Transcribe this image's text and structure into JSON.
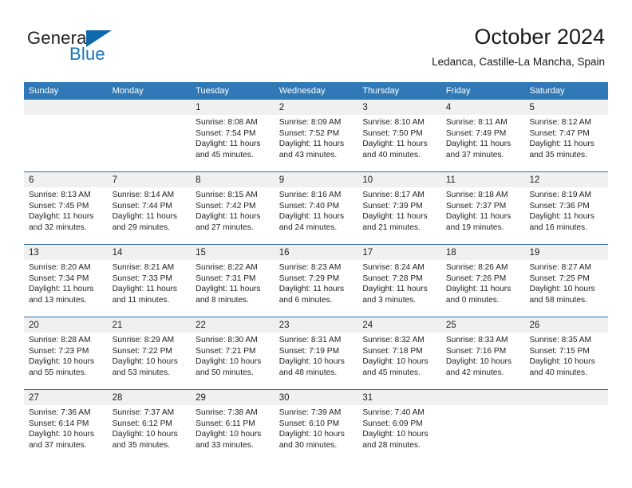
{
  "brand": {
    "word_general": "General",
    "word_blue": "Blue",
    "flag_icon": "triangle-flag-icon",
    "accent_color": "#1574b8"
  },
  "header": {
    "title": "October 2024",
    "subtitle": "Ledanca, Castille-La Mancha, Spain",
    "header_bg_color": "#3079b6",
    "row_divider_color": "#2f6ea5",
    "day_band_color": "#f0f0f0"
  },
  "weekdays": [
    "Sunday",
    "Monday",
    "Tuesday",
    "Wednesday",
    "Thursday",
    "Friday",
    "Saturday"
  ],
  "weeks": [
    [
      {
        "day": "",
        "lines": []
      },
      {
        "day": "",
        "lines": []
      },
      {
        "day": "1",
        "lines": [
          "Sunrise: 8:08 AM",
          "Sunset: 7:54 PM",
          "Daylight: 11 hours",
          "and 45 minutes."
        ]
      },
      {
        "day": "2",
        "lines": [
          "Sunrise: 8:09 AM",
          "Sunset: 7:52 PM",
          "Daylight: 11 hours",
          "and 43 minutes."
        ]
      },
      {
        "day": "3",
        "lines": [
          "Sunrise: 8:10 AM",
          "Sunset: 7:50 PM",
          "Daylight: 11 hours",
          "and 40 minutes."
        ]
      },
      {
        "day": "4",
        "lines": [
          "Sunrise: 8:11 AM",
          "Sunset: 7:49 PM",
          "Daylight: 11 hours",
          "and 37 minutes."
        ]
      },
      {
        "day": "5",
        "lines": [
          "Sunrise: 8:12 AM",
          "Sunset: 7:47 PM",
          "Daylight: 11 hours",
          "and 35 minutes."
        ]
      }
    ],
    [
      {
        "day": "6",
        "lines": [
          "Sunrise: 8:13 AM",
          "Sunset: 7:45 PM",
          "Daylight: 11 hours",
          "and 32 minutes."
        ]
      },
      {
        "day": "7",
        "lines": [
          "Sunrise: 8:14 AM",
          "Sunset: 7:44 PM",
          "Daylight: 11 hours",
          "and 29 minutes."
        ]
      },
      {
        "day": "8",
        "lines": [
          "Sunrise: 8:15 AM",
          "Sunset: 7:42 PM",
          "Daylight: 11 hours",
          "and 27 minutes."
        ]
      },
      {
        "day": "9",
        "lines": [
          "Sunrise: 8:16 AM",
          "Sunset: 7:40 PM",
          "Daylight: 11 hours",
          "and 24 minutes."
        ]
      },
      {
        "day": "10",
        "lines": [
          "Sunrise: 8:17 AM",
          "Sunset: 7:39 PM",
          "Daylight: 11 hours",
          "and 21 minutes."
        ]
      },
      {
        "day": "11",
        "lines": [
          "Sunrise: 8:18 AM",
          "Sunset: 7:37 PM",
          "Daylight: 11 hours",
          "and 19 minutes."
        ]
      },
      {
        "day": "12",
        "lines": [
          "Sunrise: 8:19 AM",
          "Sunset: 7:36 PM",
          "Daylight: 11 hours",
          "and 16 minutes."
        ]
      }
    ],
    [
      {
        "day": "13",
        "lines": [
          "Sunrise: 8:20 AM",
          "Sunset: 7:34 PM",
          "Daylight: 11 hours",
          "and 13 minutes."
        ]
      },
      {
        "day": "14",
        "lines": [
          "Sunrise: 8:21 AM",
          "Sunset: 7:33 PM",
          "Daylight: 11 hours",
          "and 11 minutes."
        ]
      },
      {
        "day": "15",
        "lines": [
          "Sunrise: 8:22 AM",
          "Sunset: 7:31 PM",
          "Daylight: 11 hours",
          "and 8 minutes."
        ]
      },
      {
        "day": "16",
        "lines": [
          "Sunrise: 8:23 AM",
          "Sunset: 7:29 PM",
          "Daylight: 11 hours",
          "and 6 minutes."
        ]
      },
      {
        "day": "17",
        "lines": [
          "Sunrise: 8:24 AM",
          "Sunset: 7:28 PM",
          "Daylight: 11 hours",
          "and 3 minutes."
        ]
      },
      {
        "day": "18",
        "lines": [
          "Sunrise: 8:26 AM",
          "Sunset: 7:26 PM",
          "Daylight: 11 hours",
          "and 0 minutes."
        ]
      },
      {
        "day": "19",
        "lines": [
          "Sunrise: 8:27 AM",
          "Sunset: 7:25 PM",
          "Daylight: 10 hours",
          "and 58 minutes."
        ]
      }
    ],
    [
      {
        "day": "20",
        "lines": [
          "Sunrise: 8:28 AM",
          "Sunset: 7:23 PM",
          "Daylight: 10 hours",
          "and 55 minutes."
        ]
      },
      {
        "day": "21",
        "lines": [
          "Sunrise: 8:29 AM",
          "Sunset: 7:22 PM",
          "Daylight: 10 hours",
          "and 53 minutes."
        ]
      },
      {
        "day": "22",
        "lines": [
          "Sunrise: 8:30 AM",
          "Sunset: 7:21 PM",
          "Daylight: 10 hours",
          "and 50 minutes."
        ]
      },
      {
        "day": "23",
        "lines": [
          "Sunrise: 8:31 AM",
          "Sunset: 7:19 PM",
          "Daylight: 10 hours",
          "and 48 minutes."
        ]
      },
      {
        "day": "24",
        "lines": [
          "Sunrise: 8:32 AM",
          "Sunset: 7:18 PM",
          "Daylight: 10 hours",
          "and 45 minutes."
        ]
      },
      {
        "day": "25",
        "lines": [
          "Sunrise: 8:33 AM",
          "Sunset: 7:16 PM",
          "Daylight: 10 hours",
          "and 42 minutes."
        ]
      },
      {
        "day": "26",
        "lines": [
          "Sunrise: 8:35 AM",
          "Sunset: 7:15 PM",
          "Daylight: 10 hours",
          "and 40 minutes."
        ]
      }
    ],
    [
      {
        "day": "27",
        "lines": [
          "Sunrise: 7:36 AM",
          "Sunset: 6:14 PM",
          "Daylight: 10 hours",
          "and 37 minutes."
        ]
      },
      {
        "day": "28",
        "lines": [
          "Sunrise: 7:37 AM",
          "Sunset: 6:12 PM",
          "Daylight: 10 hours",
          "and 35 minutes."
        ]
      },
      {
        "day": "29",
        "lines": [
          "Sunrise: 7:38 AM",
          "Sunset: 6:11 PM",
          "Daylight: 10 hours",
          "and 33 minutes."
        ]
      },
      {
        "day": "30",
        "lines": [
          "Sunrise: 7:39 AM",
          "Sunset: 6:10 PM",
          "Daylight: 10 hours",
          "and 30 minutes."
        ]
      },
      {
        "day": "31",
        "lines": [
          "Sunrise: 7:40 AM",
          "Sunset: 6:09 PM",
          "Daylight: 10 hours",
          "and 28 minutes."
        ]
      },
      {
        "day": "",
        "lines": []
      },
      {
        "day": "",
        "lines": []
      }
    ]
  ]
}
